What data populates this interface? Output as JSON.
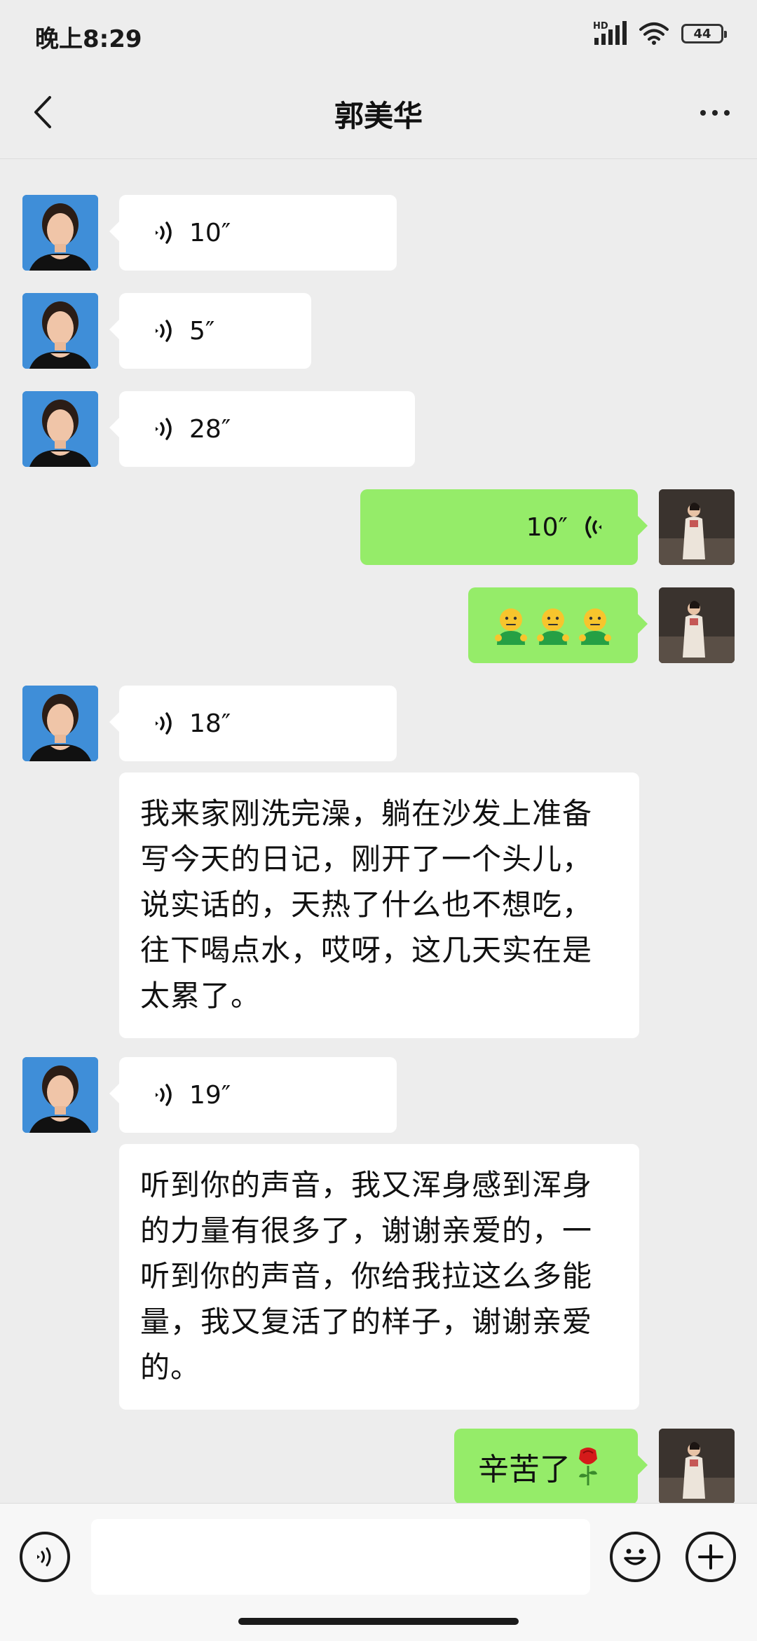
{
  "status_bar": {
    "time": "晚上8:29",
    "network_label": "HD",
    "battery": "44"
  },
  "header": {
    "title": "郭美华"
  },
  "messages": [
    {
      "side": "in",
      "type": "voice",
      "duration": "10″"
    },
    {
      "side": "in",
      "type": "voice",
      "duration": "5″"
    },
    {
      "side": "in",
      "type": "voice",
      "duration": "28″"
    },
    {
      "side": "out",
      "type": "voice",
      "duration": "10″"
    },
    {
      "side": "out",
      "type": "emoji",
      "text": "🙎🙎🙎"
    },
    {
      "side": "in",
      "type": "voice",
      "duration": "18″"
    },
    {
      "side": "in",
      "type": "text",
      "text": "我来家刚洗完澡，躺在沙发上准备写今天的日记，刚开了一个头儿，说实话的，天热了什么也不想吃，往下喝点水，哎呀，这几天实在是太累了。"
    },
    {
      "side": "in",
      "type": "voice",
      "duration": "19″"
    },
    {
      "side": "in",
      "type": "text",
      "text": "听到你的声音，我又浑身感到浑身的力量有很多了，谢谢亲爱的，一听到你的声音，你给我拉这么多能量，我又复活了的样子，谢谢亲爱的。"
    },
    {
      "side": "out",
      "type": "text",
      "text": "辛苦了",
      "emoji": "🌹"
    }
  ],
  "input": {
    "value": "",
    "placeholder": ""
  },
  "colors": {
    "background": "#ededed",
    "incoming_bubble": "#ffffff",
    "outgoing_bubble": "#95ec69"
  }
}
